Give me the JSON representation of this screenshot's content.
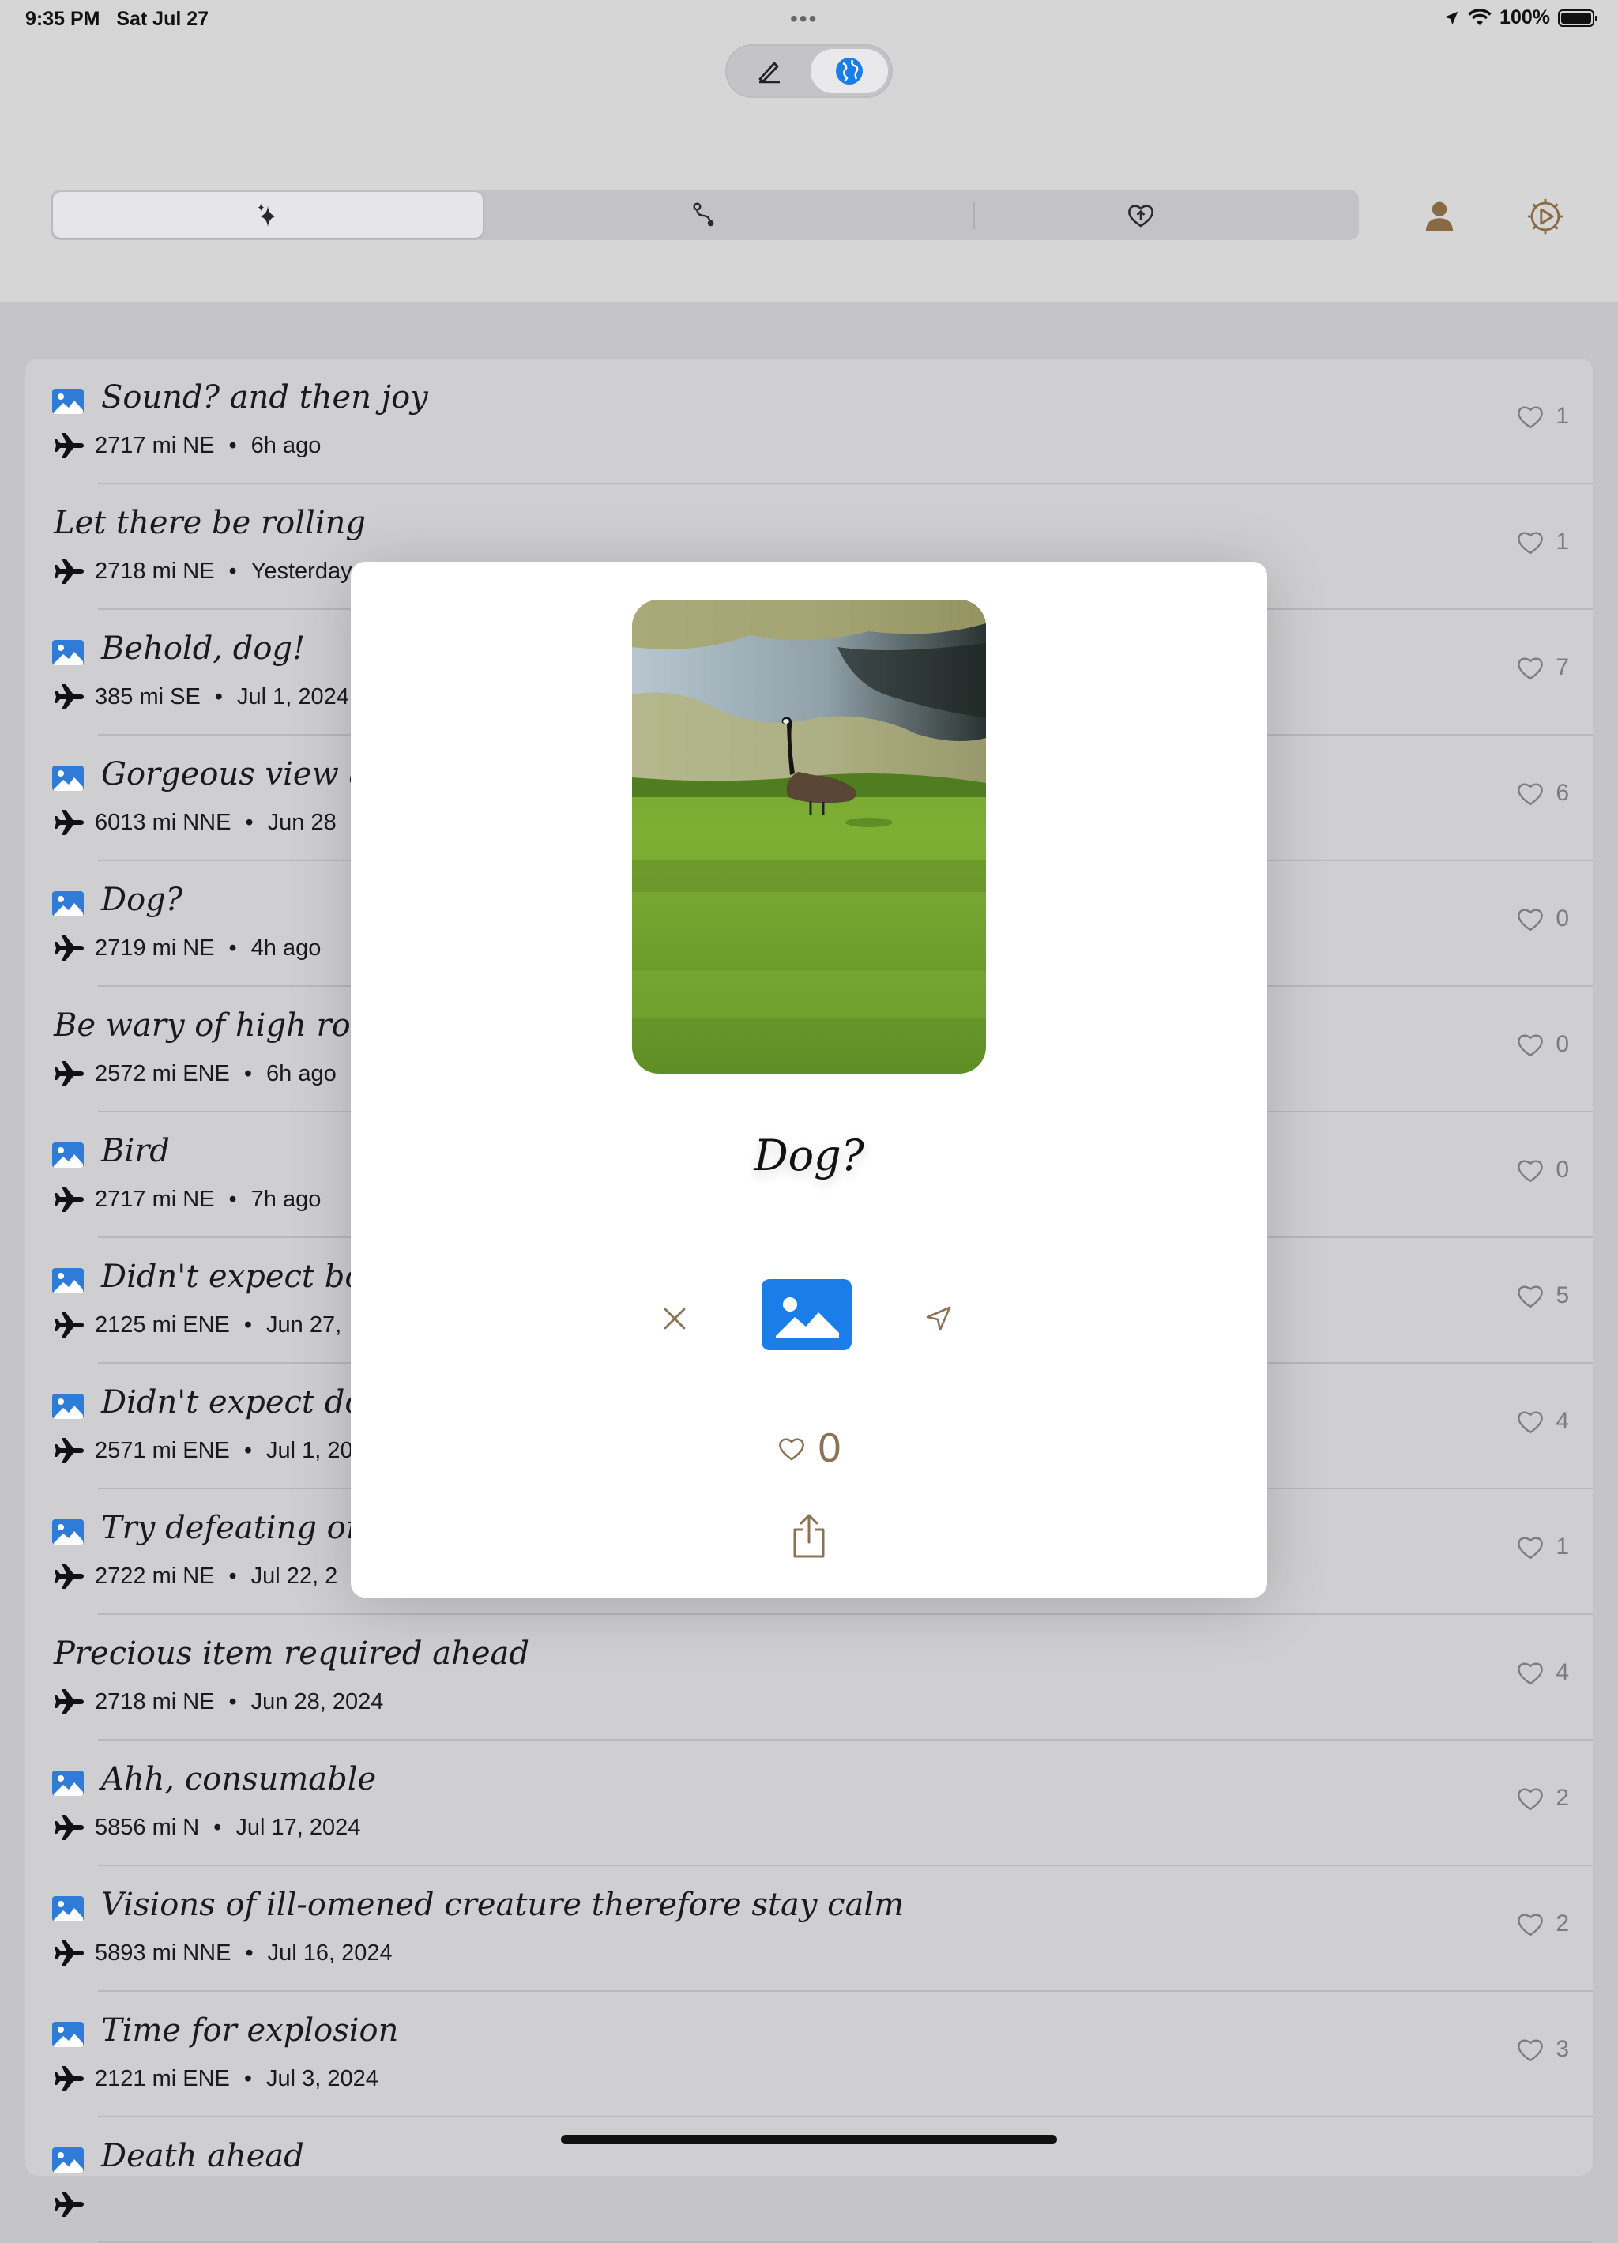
{
  "status_bar": {
    "time": "9:35 PM",
    "date": "Sat Jul 27",
    "battery": "100%"
  },
  "header": {
    "mode_toggle": {
      "left_icon": "pencil-icon",
      "right_icon": "globe-icon"
    },
    "tabs": [
      {
        "icon": "sparkles-icon"
      },
      {
        "icon": "route-icon"
      },
      {
        "icon": "heart-upload-icon"
      }
    ],
    "profile_icon": "person-icon",
    "settings_icon": "gear-icon"
  },
  "messages": [
    {
      "title": "Sound? and then joy",
      "has_image": true,
      "distance": "2717 mi NE",
      "time": "6h ago",
      "likes": "1"
    },
    {
      "title": "Let there be rolling",
      "has_image": false,
      "distance": "2718 mi NE",
      "time": "Yesterday",
      "likes": "1"
    },
    {
      "title": "Behold, dog!",
      "has_image": true,
      "distance": "385 mi SE",
      "time": "Jul 1, 2024",
      "likes": "7"
    },
    {
      "title": "Gorgeous view a",
      "has_image": true,
      "distance": "6013 mi NNE",
      "time": "Jun 28",
      "likes": "6"
    },
    {
      "title": "Dog?",
      "has_image": true,
      "distance": "2719 mi NE",
      "time": "4h ago",
      "likes": "0"
    },
    {
      "title": "Be wary of high roa",
      "has_image": false,
      "distance": "2572 mi ENE",
      "time": "6h ago",
      "likes": "0"
    },
    {
      "title": "Bird",
      "has_image": true,
      "distance": "2717 mi NE",
      "time": "7h ago",
      "likes": "0"
    },
    {
      "title": "Didn't expect bo",
      "has_image": true,
      "distance": "2125 mi ENE",
      "time": "Jun 27,",
      "likes": "5"
    },
    {
      "title": "Didn't expect do",
      "has_image": true,
      "distance": "2571 mi ENE",
      "time": "Jul 1, 20",
      "likes": "4"
    },
    {
      "title": "Try defeating on",
      "has_image": true,
      "distance": "2722 mi NE",
      "time": "Jul 22, 2",
      "likes": "1"
    },
    {
      "title": "Precious item required ahead",
      "has_image": false,
      "distance": "2718 mi NE",
      "time": "Jun 28, 2024",
      "likes": "4"
    },
    {
      "title": "Ahh, consumable",
      "has_image": true,
      "distance": "5856 mi N",
      "time": "Jul 17, 2024",
      "likes": "2"
    },
    {
      "title": "Visions of ill-omened creature therefore stay calm",
      "has_image": true,
      "distance": "5893 mi NNE",
      "time": "Jul 16, 2024",
      "likes": "2"
    },
    {
      "title": "Time for explosion",
      "has_image": true,
      "distance": "2121 mi ENE",
      "time": "Jul 3, 2024",
      "likes": "3"
    },
    {
      "title": "Death ahead",
      "has_image": true,
      "distance": "",
      "time": "",
      "likes": ""
    }
  ],
  "modal": {
    "title": "Dog?",
    "likes": "0",
    "actions": {
      "close_icon": "close-icon",
      "media_icon": "photo-icon",
      "send_icon": "location-arrow-icon",
      "share_icon": "share-icon"
    }
  },
  "colors": {
    "accent_brown": "#8a7354",
    "accent_blue": "#1a7de8",
    "list_bg": "#cfcfd1",
    "header_bg": "#d6d6d6"
  }
}
